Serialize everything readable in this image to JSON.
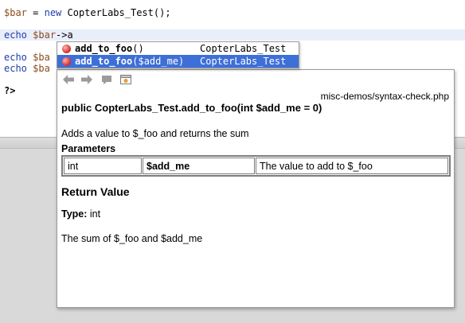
{
  "editor": {
    "line1": {
      "var": "$bar",
      "op": " = ",
      "kw": "new",
      "rest": " CopterLabs_Test();"
    },
    "line2": {
      "kw": "echo",
      "sp": " ",
      "var": "$bar",
      "rest": "->a"
    },
    "line3": {
      "kw": "echo",
      "sp": " ",
      "var": "$ba"
    },
    "line4": {
      "kw": "echo",
      "sp": " ",
      "var": "$ba"
    },
    "line5": {
      "text": "?>"
    }
  },
  "completion": {
    "items": [
      {
        "name": "add_to_foo",
        "args": "()",
        "class": "CopterLabs_Test",
        "selected": false,
        "icon": "method-icon"
      },
      {
        "name": "add_to_foo",
        "args": "($add_me)",
        "class": "CopterLabs_Test",
        "selected": true,
        "icon": "method-icon"
      }
    ]
  },
  "doc": {
    "toolbar": {
      "back": "⇦",
      "forward": "⇨",
      "icons": [
        "back-arrow-icon",
        "forward-arrow-icon",
        "goto-source-icon",
        "open-browser-icon"
      ]
    },
    "path": "misc-demos/syntax-check.php",
    "signature": "public CopterLabs_Test.add_to_foo(int $add_me = 0)",
    "description": "Adds a value to $_foo and returns the sum",
    "params_heading": "Parameters",
    "params": [
      {
        "type": "int",
        "name": "$add_me",
        "desc": "The value to add to $_foo"
      }
    ],
    "return_heading": "Return Value",
    "type_label": "Type:",
    "type_value": " int",
    "return_desc": "The sum of $_foo and $add_me"
  }
}
